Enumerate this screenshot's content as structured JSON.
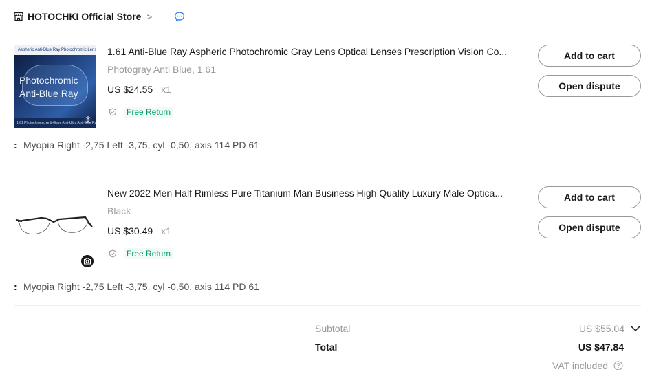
{
  "store": {
    "name": "HOTOCHKI Official Store",
    "chevron": ">",
    "icons": {
      "store": "store-icon",
      "chat": "chat-icon"
    }
  },
  "items": [
    {
      "title": "1.61 Anti-Blue Ray Aspheric Photochromic Gray Lens Optical Lenses Prescription Vision Co...",
      "variant": "Photogray Anti Blue, 1.61",
      "price": "US $24.55",
      "qty": "x1",
      "return_label": "Free Return",
      "add_to_cart": "Add to cart",
      "open_dispute": "Open dispute",
      "note_colon": ":",
      "note": "Myopia Right -2,75 Left -3,75, cyl -0,50, axis 114 PD 61",
      "thumb_caption": "Photochromic Anti-Blue Ray",
      "thumb_top": "Aspheric Anti-Blue Ray Photochromic Lenses",
      "thumb_bottom": "1.61  Photochromic  Anti-Glare  Anti-Ultra Anti-Blue Ray  Anti-Radiation  Anti-Scratch"
    },
    {
      "title": "New 2022 Men Half Rimless Pure Titanium Man Business High Quality Luxury Male Optica...",
      "variant": "Black",
      "price": "US $30.49",
      "qty": "x1",
      "return_label": "Free Return",
      "add_to_cart": "Add to cart",
      "open_dispute": "Open dispute",
      "note_colon": ":",
      "note": "Myopia Right -2,75 Left -3,75, cyl -0,50, axis 114 PD 61"
    }
  ],
  "summary": {
    "subtotal_label": "Subtotal",
    "subtotal_value": "US $55.04",
    "total_label": "Total",
    "total_value": "US $47.84",
    "vat_label": "VAT included"
  },
  "colors": {
    "text": "#191919",
    "muted": "#999999",
    "return_green": "#00a06a",
    "chat_blue": "#2b7ff2",
    "button_border": "#999999"
  }
}
